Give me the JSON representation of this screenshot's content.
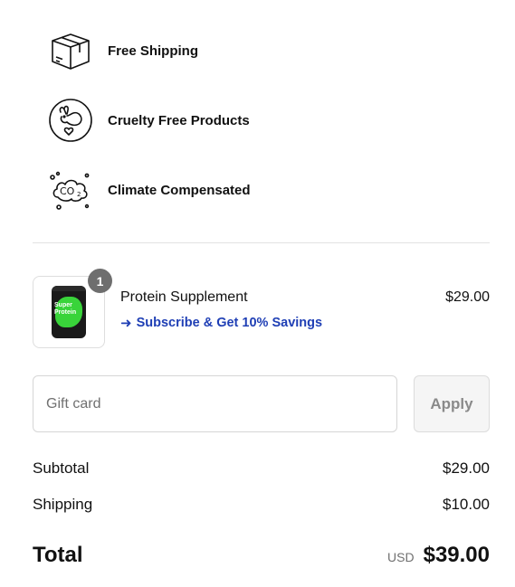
{
  "perks": [
    {
      "label": "Free Shipping",
      "icon": "box-icon"
    },
    {
      "label": "Cruelty Free Products",
      "icon": "rabbit-heart-icon"
    },
    {
      "label": "Climate Compensated",
      "icon": "co2-cloud-icon"
    }
  ],
  "line_item": {
    "quantity": "1",
    "image_text": "Super Protein",
    "name": "Protein Supplement",
    "price": "$29.00",
    "promo_arrow": "➜",
    "promo_text": "Subscribe & Get 10% Savings"
  },
  "gift_card": {
    "placeholder": "Gift card",
    "apply_label": "Apply"
  },
  "summary": {
    "subtotal_label": "Subtotal",
    "subtotal_value": "$29.00",
    "shipping_label": "Shipping",
    "shipping_value": "$10.00",
    "total_label": "Total",
    "currency": "USD",
    "total_value": "$39.00"
  },
  "colors": {
    "promo": "#1f3fb5",
    "badge": "#6e6e6e",
    "accent_green": "#39d43a"
  }
}
